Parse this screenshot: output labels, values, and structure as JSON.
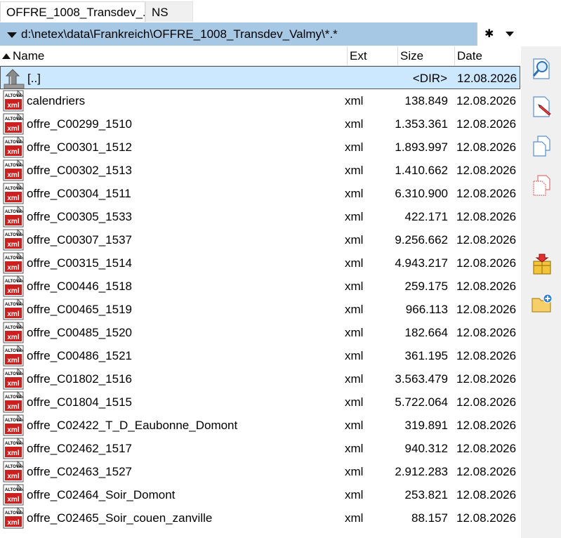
{
  "tabs": [
    {
      "label": "OFFRE_1008_Transdev_..",
      "active": true
    },
    {
      "label": "NS",
      "active": false
    }
  ],
  "path": {
    "value": "d:\\netex\\data\\Frankreich\\OFFRE_1008_Transdev_Valmy\\*.*",
    "filter_icon": "asterisk-icon"
  },
  "columns": {
    "name": "Name",
    "ext": "Ext",
    "size": "Size",
    "date": "Date"
  },
  "parent_row": {
    "name": "[..]",
    "ext": "",
    "size": "<DIR>",
    "date": "12.08.2026"
  },
  "files": [
    {
      "name": "calendriers",
      "ext": "xml",
      "size": "138.849",
      "date": "12.08.2026"
    },
    {
      "name": "offre_C00299_1510",
      "ext": "xml",
      "size": "1.353.361",
      "date": "12.08.2026"
    },
    {
      "name": "offre_C00301_1512",
      "ext": "xml",
      "size": "1.893.997",
      "date": "12.08.2026"
    },
    {
      "name": "offre_C00302_1513",
      "ext": "xml",
      "size": "1.410.662",
      "date": "12.08.2026"
    },
    {
      "name": "offre_C00304_1511",
      "ext": "xml",
      "size": "6.310.900",
      "date": "12.08.2026"
    },
    {
      "name": "offre_C00305_1533",
      "ext": "xml",
      "size": "422.171",
      "date": "12.08.2026"
    },
    {
      "name": "offre_C00307_1537",
      "ext": "xml",
      "size": "9.256.662",
      "date": "12.08.2026"
    },
    {
      "name": "offre_C00315_1514",
      "ext": "xml",
      "size": "4.943.217",
      "date": "12.08.2026"
    },
    {
      "name": "offre_C00446_1518",
      "ext": "xml",
      "size": "259.175",
      "date": "12.08.2026"
    },
    {
      "name": "offre_C00465_1519",
      "ext": "xml",
      "size": "966.113",
      "date": "12.08.2026"
    },
    {
      "name": "offre_C00485_1520",
      "ext": "xml",
      "size": "182.664",
      "date": "12.08.2026"
    },
    {
      "name": "offre_C00486_1521",
      "ext": "xml",
      "size": "361.195",
      "date": "12.08.2026"
    },
    {
      "name": "offre_C01802_1516",
      "ext": "xml",
      "size": "3.563.479",
      "date": "12.08.2026"
    },
    {
      "name": "offre_C01804_1515",
      "ext": "xml",
      "size": "5.722.064",
      "date": "12.08.2026"
    },
    {
      "name": "offre_C02422_T_D_Eaubonne_Domont",
      "ext": "xml",
      "size": "319.891",
      "date": "12.08.2026"
    },
    {
      "name": "offre_C02462_1517",
      "ext": "xml",
      "size": "940.312",
      "date": "12.08.2026"
    },
    {
      "name": "offre_C02463_1527",
      "ext": "xml",
      "size": "2.912.283",
      "date": "12.08.2026"
    },
    {
      "name": "offre_C02464_Soir_Domont",
      "ext": "xml",
      "size": "253.821",
      "date": "12.08.2026"
    },
    {
      "name": "offre_C02465_Soir_couen_zanville",
      "ext": "xml",
      "size": "88.157",
      "date": "12.08.2026"
    }
  ],
  "file_icon": {
    "brand": "ALTOVA",
    "type": "xml",
    "name": "xml-file-icon",
    "color": "#cc1f1f"
  },
  "sidebar": [
    {
      "name": "open-preview-icon"
    },
    {
      "name": "edit-file-icon"
    },
    {
      "name": "copy-file-icon"
    },
    {
      "name": "copy-file-red-icon"
    },
    {
      "name": "archive-package-icon"
    },
    {
      "name": "new-folder-icon"
    }
  ],
  "colors": {
    "path_bar": "#a6c8e5",
    "selection": "#cce8ff",
    "sidebar_bg": "#f0f0f0"
  }
}
